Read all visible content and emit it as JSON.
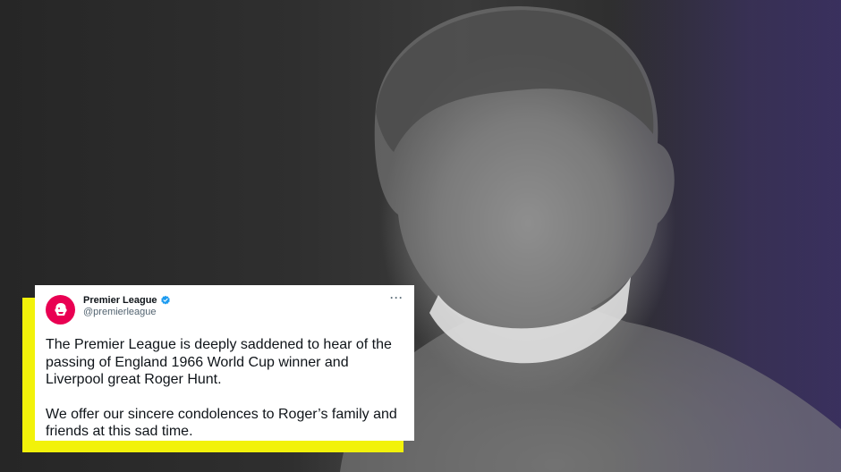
{
  "background": {
    "photo_icon": "player-portrait",
    "accent_colors": {
      "highlight": "#f2f20a",
      "brand": "#e90052",
      "verified": "#1d9bf0"
    }
  },
  "tweet": {
    "display_name": "Premier League",
    "handle": "@premierleague",
    "avatar_icon": "premier-league-lion-icon",
    "verified_icon": "verified-badge-icon",
    "more_icon": "more-options-icon",
    "more_label": "···",
    "paragraphs": [
      "The Premier League is deeply saddened to hear of the passing of England 1966 World Cup winner and Liverpool great Roger Hunt.",
      "We offer our sincere condolences to Roger’s family and friends at this sad time."
    ]
  }
}
